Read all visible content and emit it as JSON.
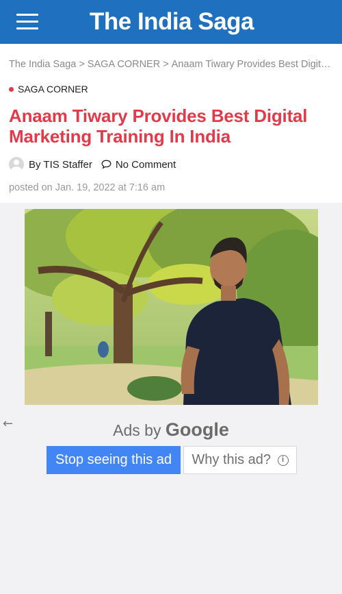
{
  "header": {
    "site_title": "The India Saga",
    "menu_icon": "hamburger-menu-icon",
    "background_color": "#1f71bf"
  },
  "breadcrumb": {
    "items": [
      "The India Saga",
      "SAGA CORNER",
      "Anaam Tiwary Provides Best Digital Marketing Training In India"
    ],
    "separator": ">"
  },
  "article": {
    "category": "SAGA CORNER",
    "title": "Anaam Tiwary Provides Best Digital Marketing Training In India",
    "author": "By TIS Staffer",
    "comments": "No Comment",
    "posted": "posted on Jan. 19, 2022 at 7:16 am",
    "accent_color": "#e33a4a"
  },
  "ad": {
    "ads_by_prefix": "Ads by",
    "ads_by_brand": "Google",
    "stop_button": "Stop seeing this ad",
    "why_button": "Why this ad?",
    "back_icon": "back-arrow-icon",
    "button_color": "#4285f4"
  }
}
